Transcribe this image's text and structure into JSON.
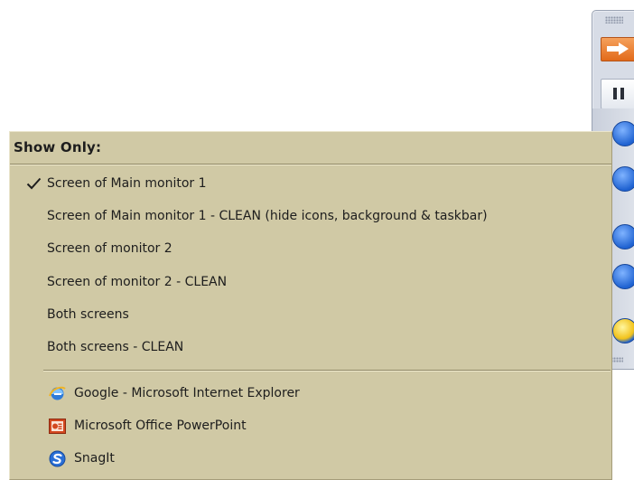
{
  "menu": {
    "header": "Show Only:",
    "screen_items": [
      {
        "label": "Screen of Main monitor 1",
        "checked": true
      },
      {
        "label": "Screen of Main monitor 1 - CLEAN (hide icons, background & taskbar)",
        "checked": false
      },
      {
        "label": "Screen of monitor 2",
        "checked": false
      },
      {
        "label": "Screen of monitor 2 - CLEAN",
        "checked": false
      },
      {
        "label": "Both screens",
        "checked": false
      },
      {
        "label": "Both screens - CLEAN",
        "checked": false
      }
    ],
    "window_items": [
      {
        "label": "Google - Microsoft Internet Explorer",
        "icon": "internet-explorer-icon"
      },
      {
        "label": "Microsoft Office PowerPoint",
        "icon": "powerpoint-icon"
      },
      {
        "label": "SnagIt",
        "icon": "snagit-icon"
      }
    ]
  },
  "toolbar": {
    "buttons": [
      "arrow-right-icon",
      "pause-icon",
      "record-icon",
      "stop-icon",
      "monitor-icon",
      "display-icon",
      "light-icon"
    ]
  },
  "colors": {
    "menu_background": "#d0c9a5",
    "toolbar_accent": "#e26a1a"
  }
}
